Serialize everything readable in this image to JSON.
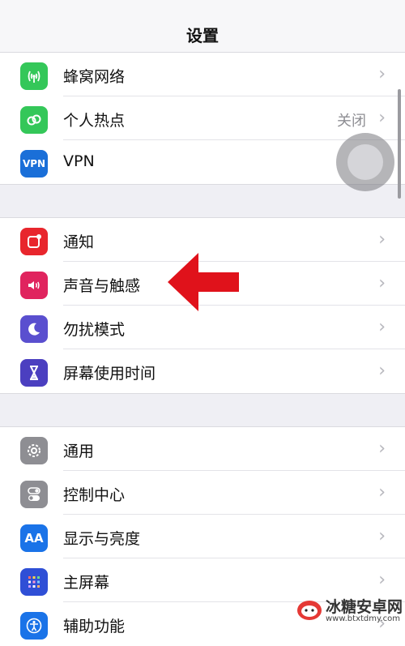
{
  "nav": {
    "title": "设置"
  },
  "groups": [
    {
      "rows": [
        {
          "label": "蜂窝网络",
          "icon": "cellular-antenna-icon",
          "color": "#34c759",
          "value": ""
        },
        {
          "label": "个人热点",
          "icon": "personal-hotspot-icon",
          "color": "#34c759",
          "value": "关闭"
        },
        {
          "label": "VPN",
          "icon": "vpn-icon",
          "icon_text": "VPN",
          "color": "#1a6fd8",
          "value": ""
        }
      ]
    },
    {
      "rows": [
        {
          "label": "通知",
          "icon": "notifications-icon",
          "color": "#e8262d",
          "value": ""
        },
        {
          "label": "声音与触感",
          "icon": "speaker-icon",
          "color": "#e0245e",
          "value": ""
        },
        {
          "label": "勿扰模式",
          "icon": "moon-icon",
          "color": "#5a4fcf",
          "value": ""
        },
        {
          "label": "屏幕使用时间",
          "icon": "hourglass-icon",
          "color": "#4b3fc0",
          "value": ""
        }
      ]
    },
    {
      "rows": [
        {
          "label": "通用",
          "icon": "gear-icon",
          "color": "#8e8e93",
          "value": ""
        },
        {
          "label": "控制中心",
          "icon": "toggle-switches-icon",
          "color": "#8e8e93",
          "value": ""
        },
        {
          "label": "显示与亮度",
          "icon": "aa-text-icon",
          "icon_text": "AA",
          "color": "#1a73e8",
          "value": ""
        },
        {
          "label": "主屏幕",
          "icon": "home-grid-icon",
          "color": "#2f4fd6",
          "value": ""
        },
        {
          "label": "辅助功能",
          "icon": "accessibility-icon",
          "color": "#1a73e8",
          "value": ""
        }
      ]
    }
  ],
  "chevron_glyph": "›",
  "annotation": {
    "color": "#e0121b",
    "points_to": "声音与触感"
  },
  "watermark": {
    "text": "冰糖安卓网",
    "url": "www.btxtdmy.com"
  }
}
